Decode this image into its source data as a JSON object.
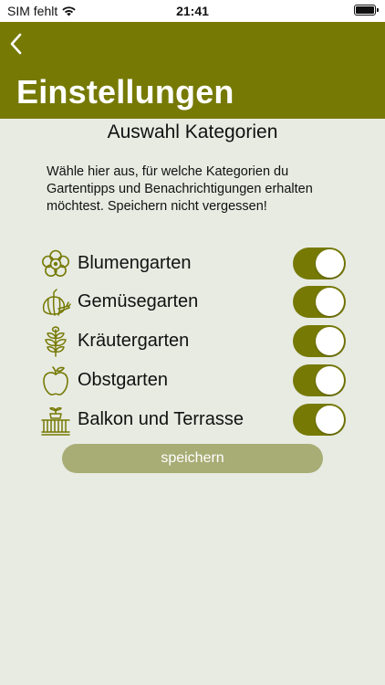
{
  "status_bar": {
    "carrier": "SIM fehlt",
    "time": "21:41"
  },
  "header": {
    "title": "Einstellungen"
  },
  "section": {
    "title": "Auswahl Kategorien",
    "description": "Wähle hier aus, für welche Kategorien du Gartentipps und Benachrichtigungen erhalten möchtest. Speichern nicht vergessen!"
  },
  "categories": [
    {
      "label": "Blumengarten",
      "icon": "flower-icon",
      "enabled": true
    },
    {
      "label": "Gemüsegarten",
      "icon": "vegetable-icon",
      "enabled": true
    },
    {
      "label": "Kräutergarten",
      "icon": "herb-icon",
      "enabled": true
    },
    {
      "label": "Obstgarten",
      "icon": "apple-icon",
      "enabled": true
    },
    {
      "label": "Balkon und Terrasse",
      "icon": "balcony-icon",
      "enabled": true
    }
  ],
  "save_button": {
    "label": "speichern"
  },
  "colors": {
    "accent": "#767a05",
    "background": "#e8ebe2",
    "button_disabled": "#a7ad75"
  }
}
